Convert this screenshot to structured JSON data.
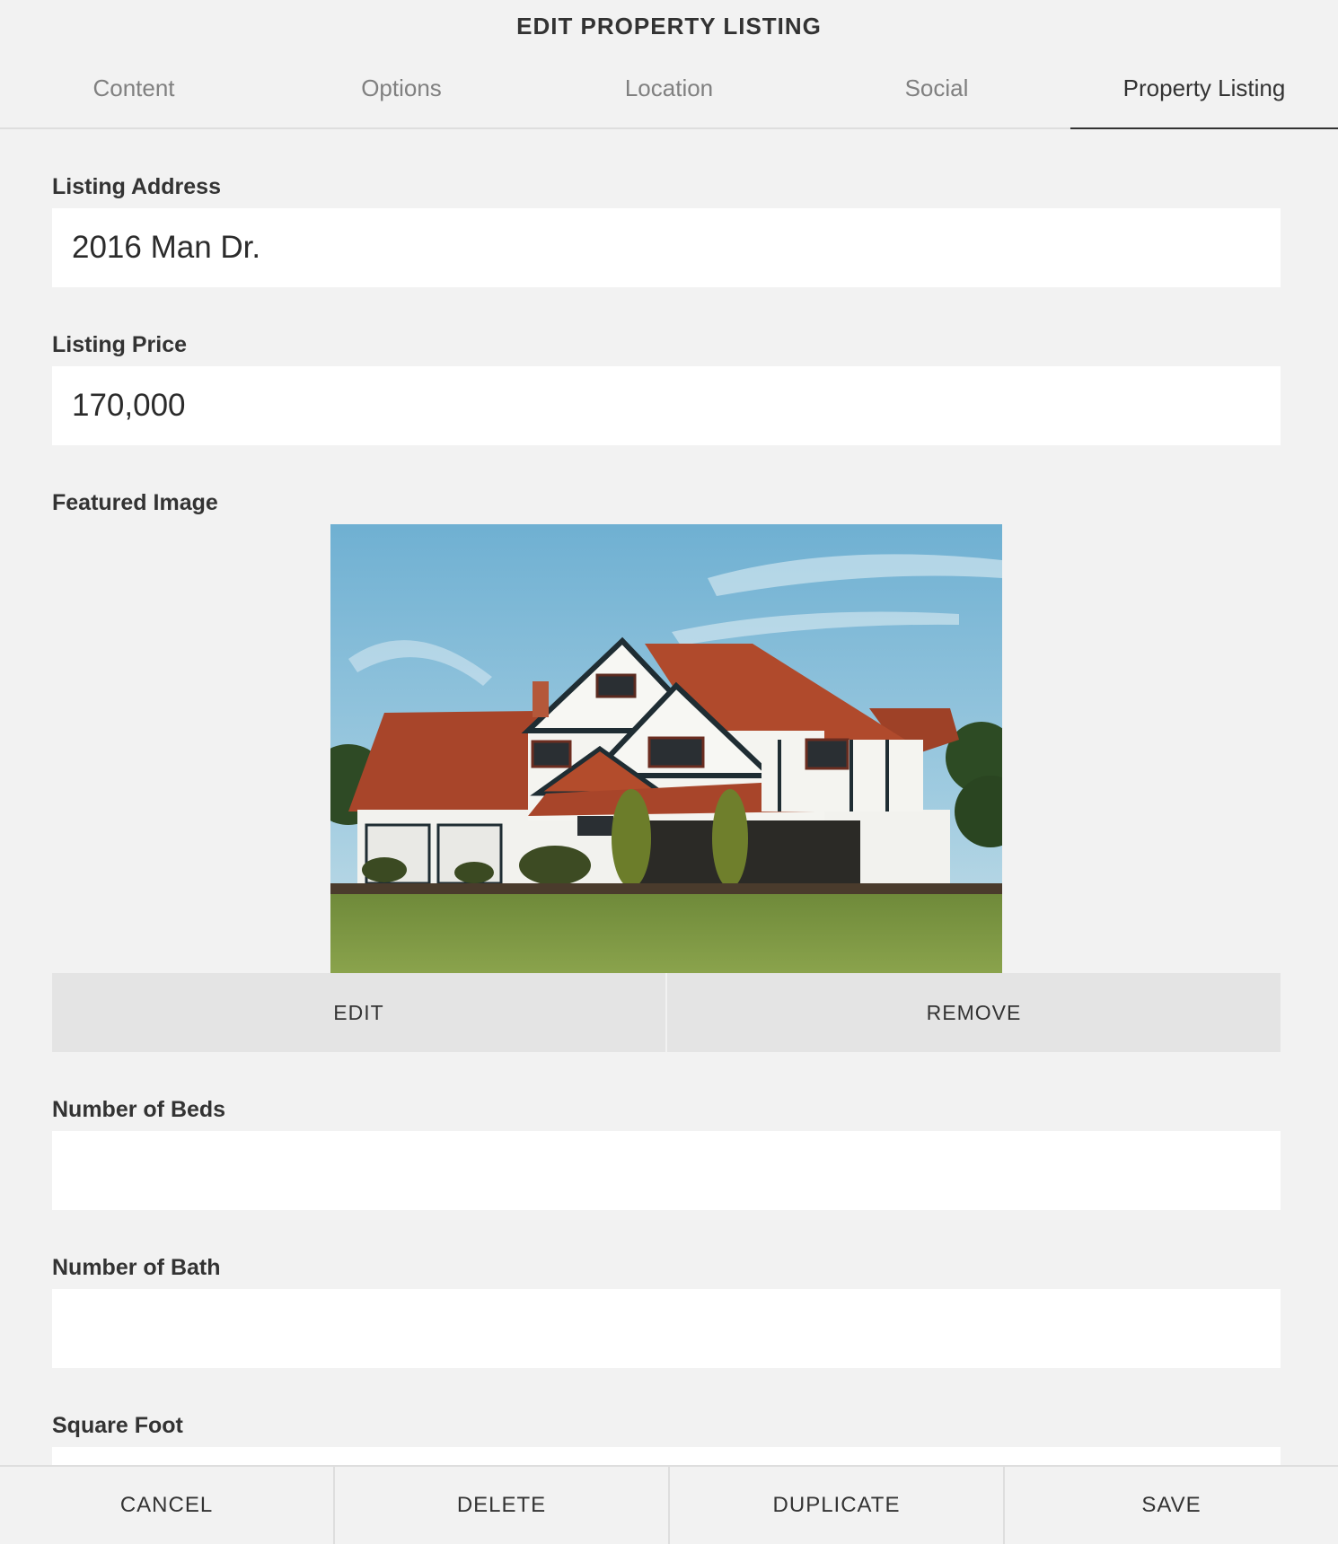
{
  "dialog": {
    "title": "EDIT PROPERTY LISTING"
  },
  "tabs": [
    {
      "label": "Content",
      "active": false
    },
    {
      "label": "Options",
      "active": false
    },
    {
      "label": "Location",
      "active": false
    },
    {
      "label": "Social",
      "active": false
    },
    {
      "label": "Property Listing",
      "active": true
    }
  ],
  "form": {
    "listing_address": {
      "label": "Listing Address",
      "value": "2016 Man Dr."
    },
    "listing_price": {
      "label": "Listing Price",
      "value": "170,000"
    },
    "featured_image": {
      "label": "Featured Image",
      "edit_label": "EDIT",
      "remove_label": "REMOVE"
    },
    "number_of_beds": {
      "label": "Number of Beds",
      "value": ""
    },
    "number_of_bath": {
      "label": "Number of Bath",
      "value": ""
    },
    "square_foot": {
      "label": "Square Foot",
      "value": ""
    }
  },
  "footer": {
    "cancel_label": "CANCEL",
    "delete_label": "DELETE",
    "duplicate_label": "DUPLICATE",
    "save_label": "SAVE"
  },
  "colors": {
    "background": "#f2f2f2",
    "input_background": "#ffffff",
    "button_background": "#e4e4e4",
    "text": "#333333",
    "tab_inactive": "#808080"
  }
}
